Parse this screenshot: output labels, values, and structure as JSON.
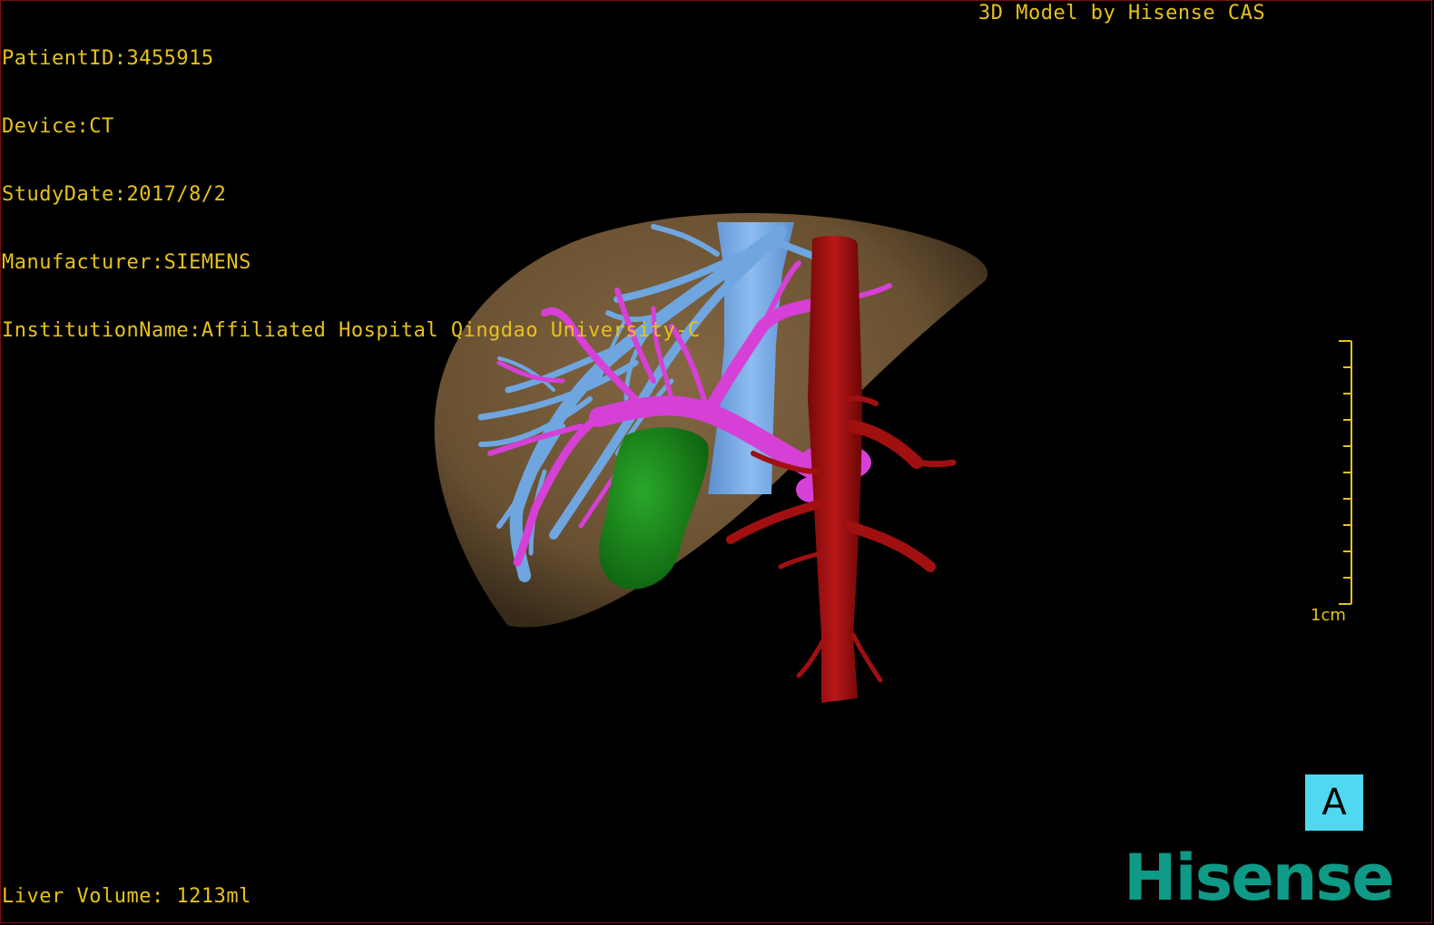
{
  "patient": {
    "id_line": "PatientID:3455915",
    "device_line": "Device:CT",
    "study_date_line": "StudyDate:2017/8/2",
    "manufacturer_line": "Manufacturer:SIEMENS",
    "institution_line": "InstitutionName:Affiliated Hospital Qingdao University-C"
  },
  "header": {
    "model_credit": "3D Model by Hisense CAS"
  },
  "footer": {
    "liver_volume": "Liver Volume: 1213ml"
  },
  "scale": {
    "label": "1cm",
    "ticks": 10
  },
  "orientation": {
    "label": "A"
  },
  "brand": {
    "logo_text": "Hisense"
  },
  "colors": {
    "overlay_text": "#e6c21a",
    "liver": "#7a5e3a",
    "hepatic_vein": "#6fa6e0",
    "portal_vein": "#d640d6",
    "artery": "#a01010",
    "gallbladder": "#1f8f1f",
    "orientation_cube": "#4fd8f0",
    "logo": "#0e9a86"
  },
  "icons": {
    "orientation": "orientation-cube-icon",
    "scale": "scale-bar-icon"
  }
}
